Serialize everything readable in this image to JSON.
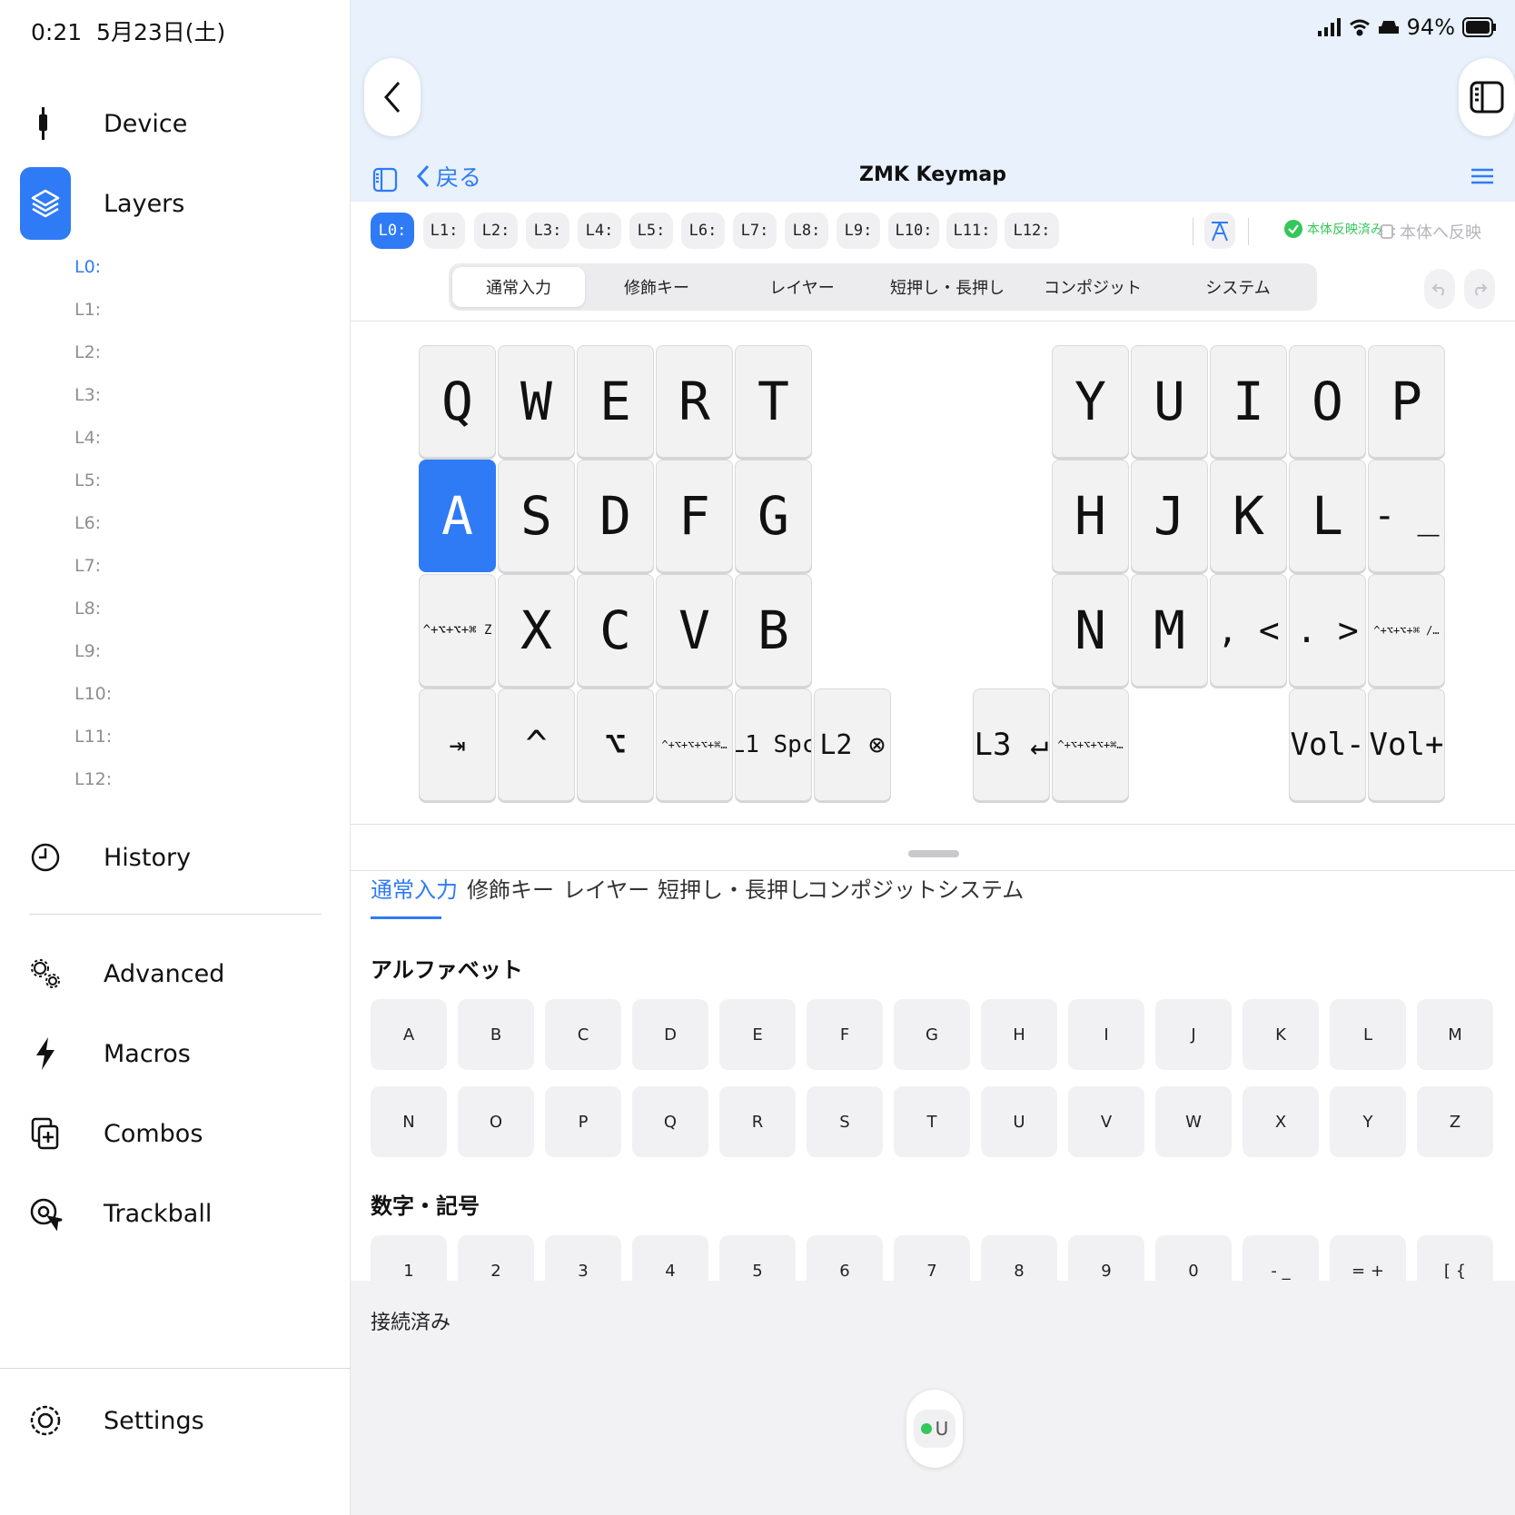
{
  "status": {
    "time": "0:21",
    "date": "5月23日(土)",
    "battery": "94%"
  },
  "sidebar": {
    "items": [
      {
        "label": "Device",
        "icon": "usb-cable-icon"
      },
      {
        "label": "Layers",
        "icon": "layers-icon"
      },
      {
        "label": "History",
        "icon": "clock-icon"
      },
      {
        "label": "Advanced",
        "icon": "gears-icon"
      },
      {
        "label": "Macros",
        "icon": "bolt-icon"
      },
      {
        "label": "Combos",
        "icon": "plus-square-icon"
      },
      {
        "label": "Trackball",
        "icon": "trackball-icon"
      },
      {
        "label": "Settings",
        "icon": "gear-icon"
      }
    ],
    "layers": [
      "L0:",
      "L1:",
      "L2:",
      "L3:",
      "L4:",
      "L5:",
      "L6:",
      "L7:",
      "L8:",
      "L9:",
      "L10:",
      "L11:",
      "L12:"
    ]
  },
  "header": {
    "back_label": "戻る",
    "title": "ZMK Keymap"
  },
  "layer_chips": [
    "L0:",
    "L1:",
    "L2:",
    "L3:",
    "L4:",
    "L5:",
    "L6:",
    "L7:",
    "L8:",
    "L9:",
    "L10:",
    "L11:",
    "L12:"
  ],
  "sync": {
    "synced": "本体反映済み",
    "apply": "本体へ反映"
  },
  "categories": [
    "通常入力",
    "修飾キー",
    "レイヤー",
    "短押し・長押し",
    "コンポジット",
    "システム"
  ],
  "keymap": {
    "left": [
      [
        "Q",
        "W",
        "E",
        "R",
        "T"
      ],
      [
        "A",
        "S",
        "D",
        "F",
        "G"
      ],
      [
        "^+⌥+⌥+⌘ Z",
        "X",
        "C",
        "V",
        "B"
      ],
      [
        "⇥",
        "^",
        "⌥",
        "^+⌥+⌥+⌥+⌘…",
        "L1 Spc",
        "L2 ⊗"
      ]
    ],
    "right": [
      [
        "Y",
        "U",
        "I",
        "O",
        "P"
      ],
      [
        "H",
        "J",
        "K",
        "L",
        "- _"
      ],
      [
        "N",
        "M",
        ", <",
        ". >",
        "^+⌥+⌥+⌘ /…"
      ],
      [
        "L3 ↵",
        "^+⌥+⌥+⌥+⌘…",
        "Vol-",
        "Vol+"
      ]
    ],
    "selected_key": "A"
  },
  "palette": {
    "sections": [
      {
        "title": "アルファベット",
        "rows": [
          [
            "A",
            "B",
            "C",
            "D",
            "E",
            "F",
            "G",
            "H",
            "I",
            "J",
            "K",
            "L",
            "M"
          ],
          [
            "N",
            "O",
            "P",
            "Q",
            "R",
            "S",
            "T",
            "U",
            "V",
            "W",
            "X",
            "Y",
            "Z"
          ]
        ]
      },
      {
        "title": "数字・記号",
        "rows": [
          [
            "1",
            "2",
            "3",
            "4",
            "5",
            "6",
            "7",
            "8",
            "9",
            "0",
            "- _",
            "= +",
            "[ {"
          ]
        ]
      }
    ]
  },
  "connection": {
    "label": "接続済み",
    "device": "U"
  },
  "colors": {
    "accent": "#2f7bf5",
    "top_bar": "#e8f1fc",
    "success": "#34c759"
  }
}
